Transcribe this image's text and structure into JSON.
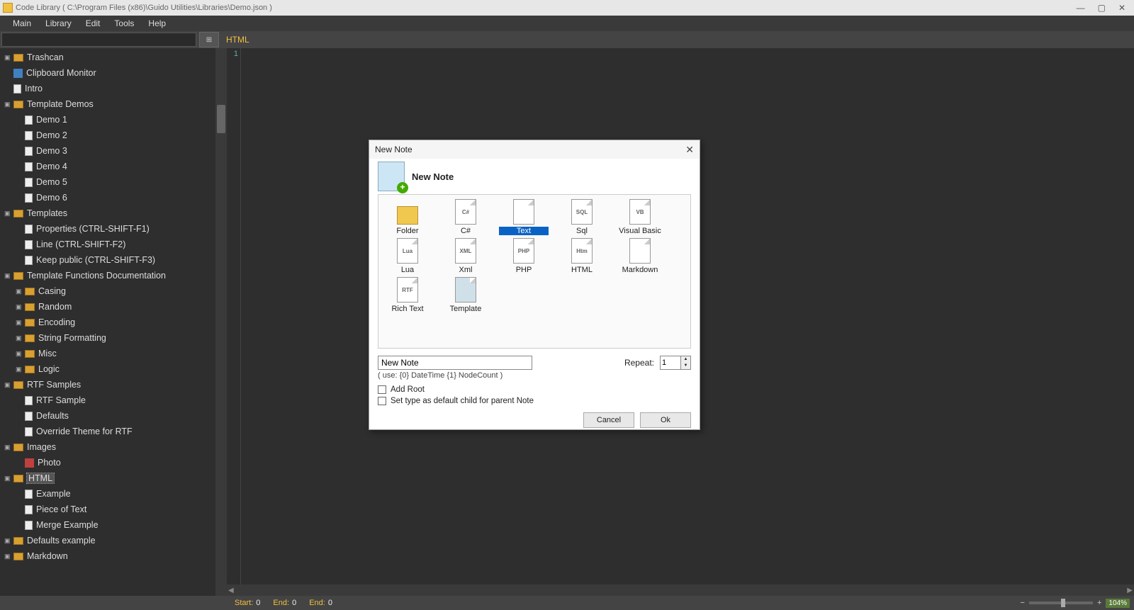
{
  "window": {
    "title": "Code Library ( C:\\Program Files (x86)\\Guido Utilities\\Libraries\\Demo.json )"
  },
  "menu": {
    "items": [
      "Main",
      "Library",
      "Edit",
      "Tools",
      "Help"
    ]
  },
  "toolbar": {
    "active_tab": "HTML"
  },
  "tree": {
    "items": [
      {
        "depth": 0,
        "type": "folder",
        "exp": "▣",
        "label": "Trashcan"
      },
      {
        "depth": 0,
        "type": "clip",
        "exp": "",
        "label": "Clipboard Monitor"
      },
      {
        "depth": 0,
        "type": "doc",
        "exp": "",
        "label": "Intro"
      },
      {
        "depth": 0,
        "type": "folder",
        "exp": "▣",
        "label": "Template Demos"
      },
      {
        "depth": 1,
        "type": "doc",
        "exp": "",
        "label": "Demo 1"
      },
      {
        "depth": 1,
        "type": "doc",
        "exp": "",
        "label": "Demo 2"
      },
      {
        "depth": 1,
        "type": "doc",
        "exp": "",
        "label": "Demo 3"
      },
      {
        "depth": 1,
        "type": "doc",
        "exp": "",
        "label": "Demo 4"
      },
      {
        "depth": 1,
        "type": "doc",
        "exp": "",
        "label": "Demo 5"
      },
      {
        "depth": 1,
        "type": "doc",
        "exp": "",
        "label": "Demo 6"
      },
      {
        "depth": 0,
        "type": "folder",
        "exp": "▣",
        "label": "Templates"
      },
      {
        "depth": 1,
        "type": "doc",
        "exp": "",
        "label": "Properties (CTRL-SHIFT-F1)"
      },
      {
        "depth": 1,
        "type": "doc",
        "exp": "",
        "label": "Line (CTRL-SHIFT-F2)"
      },
      {
        "depth": 1,
        "type": "doc",
        "exp": "",
        "label": "Keep public (CTRL-SHIFT-F3)"
      },
      {
        "depth": 0,
        "type": "folder",
        "exp": "▣",
        "label": "Template Functions Documentation"
      },
      {
        "depth": 1,
        "type": "folder",
        "exp": "▣",
        "label": "Casing"
      },
      {
        "depth": 1,
        "type": "folder",
        "exp": "▣",
        "label": "Random"
      },
      {
        "depth": 1,
        "type": "folder",
        "exp": "▣",
        "label": "Encoding"
      },
      {
        "depth": 1,
        "type": "folder",
        "exp": "▣",
        "label": "String Formatting"
      },
      {
        "depth": 1,
        "type": "folder",
        "exp": "▣",
        "label": "Misc"
      },
      {
        "depth": 1,
        "type": "folder",
        "exp": "▣",
        "label": "Logic"
      },
      {
        "depth": 0,
        "type": "folder",
        "exp": "▣",
        "label": "RTF Samples"
      },
      {
        "depth": 1,
        "type": "doc",
        "exp": "",
        "label": "RTF Sample"
      },
      {
        "depth": 1,
        "type": "doc",
        "exp": "",
        "label": "Defaults"
      },
      {
        "depth": 1,
        "type": "doc",
        "exp": "",
        "label": "Override Theme for RTF"
      },
      {
        "depth": 0,
        "type": "folder",
        "exp": "▣",
        "label": "Images"
      },
      {
        "depth": 1,
        "type": "photo",
        "exp": "",
        "label": "Photo"
      },
      {
        "depth": 0,
        "type": "folder",
        "exp": "▣",
        "label": "HTML",
        "selected": true
      },
      {
        "depth": 1,
        "type": "doc",
        "exp": "",
        "label": "Example"
      },
      {
        "depth": 1,
        "type": "doc",
        "exp": "",
        "label": "Piece of Text"
      },
      {
        "depth": 1,
        "type": "doc",
        "exp": "",
        "label": "Merge Example"
      },
      {
        "depth": 0,
        "type": "folder",
        "exp": "▣",
        "label": "Defaults example"
      },
      {
        "depth": 0,
        "type": "folder",
        "exp": "▣",
        "label": "Markdown"
      }
    ]
  },
  "editor": {
    "line_number": "1"
  },
  "status": {
    "start_lbl": "Start:",
    "start_val": "0",
    "end1_lbl": "End:",
    "end1_val": "0",
    "end2_lbl": "End:",
    "end2_val": "0",
    "zoom": "104%"
  },
  "dialog": {
    "title": "New Note",
    "heading": "New Note",
    "types": [
      {
        "label": "Folder",
        "tag": "",
        "cls": "folder"
      },
      {
        "label": "C#",
        "tag": "C#"
      },
      {
        "label": "Text",
        "tag": "",
        "selected": true
      },
      {
        "label": "Sql",
        "tag": "SQL"
      },
      {
        "label": "Visual Basic",
        "tag": "VB"
      },
      {
        "label": "Lua",
        "tag": "Lua"
      },
      {
        "label": "Xml",
        "tag": "XML"
      },
      {
        "label": "PHP",
        "tag": "PHP"
      },
      {
        "label": "HTML",
        "tag": "Htm"
      },
      {
        "label": "Markdown",
        "tag": ""
      },
      {
        "label": "Rich Text",
        "tag": "RTF"
      },
      {
        "label": "Template",
        "tag": "",
        "cls": "tmpl"
      }
    ],
    "name_value": "New Note",
    "repeat_label": "Repeat:",
    "repeat_value": "1",
    "hint": "( use: {0} DateTime {1} NodeCount )",
    "check_addroot": "Add Root",
    "check_default": "Set type as default child for parent Note",
    "btn_cancel": "Cancel",
    "btn_ok": "Ok"
  }
}
